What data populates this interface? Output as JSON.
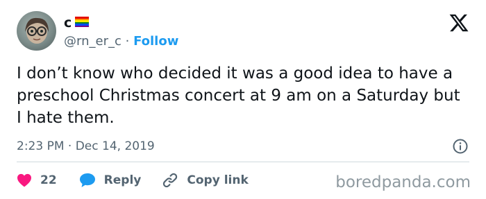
{
  "author": {
    "name": "c",
    "handle": "@rn_er_c",
    "separator": "·",
    "follow_label": "Follow",
    "flag_colors": [
      "#e40303",
      "#ff8c00",
      "#ffed00",
      "#008026",
      "#004dff",
      "#750787"
    ]
  },
  "tweet": {
    "text": "I don’t know who decided it was a good idea to have a preschool Christmas concert at 9 am on a Saturday but I hate them.",
    "timestamp": "2:23 PM · Dec 14, 2019"
  },
  "actions": {
    "likes_count": "22",
    "reply_label": "Reply",
    "copy_link_label": "Copy link"
  },
  "icons": [
    "x-logo-icon",
    "info-icon",
    "heart-icon",
    "reply-bubble-icon",
    "link-icon"
  ],
  "colors": {
    "text": "#0f1419",
    "secondary": "#536471",
    "accent": "#1d9bf0",
    "heart": "#f91880"
  },
  "watermark": "boredpanda.com"
}
